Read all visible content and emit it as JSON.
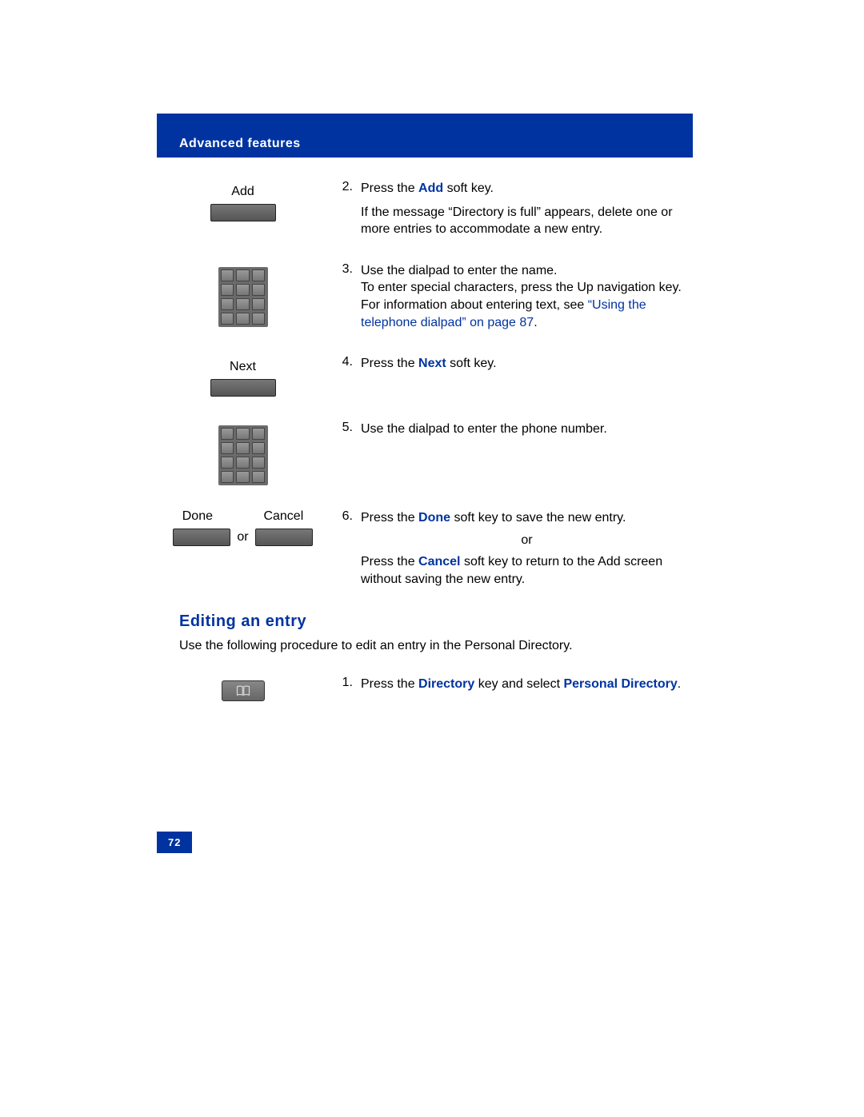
{
  "header": {
    "title": "Advanced features"
  },
  "steps": {
    "s2": {
      "label": "Add",
      "num": "2.",
      "line1_a": "Press the ",
      "line1_b": "Add",
      "line1_c": " soft key.",
      "para": "If the message “Directory is full” appears, delete one or more entries to accommodate a new entry."
    },
    "s3": {
      "num": "3.",
      "line1": "Use the dialpad to enter the name.",
      "line2": "To enter special characters, press the Up navigation key. For information about entering text, see ",
      "link": "“Using the telephone dialpad” on page 87",
      "line2_end": "."
    },
    "s4": {
      "label": "Next",
      "num": "4.",
      "a": "Press the ",
      "b": "Next",
      "c": " soft key."
    },
    "s5": {
      "num": "5.",
      "text": "Use the dialpad to enter the phone number."
    },
    "s6": {
      "label_done": "Done",
      "label_cancel": "Cancel",
      "or": "or",
      "num": "6.",
      "a": "Press the ",
      "b": "Done",
      "c": " soft key to save the new entry.",
      "or_center": "or",
      "d": "Press the ",
      "e": "Cancel",
      "f": " soft key to return to the Add screen without saving the new entry."
    }
  },
  "section2": {
    "heading": "Editing an entry",
    "intro": "Use the following procedure to edit an entry in the Personal Directory.",
    "step1": {
      "num": "1.",
      "a": "Press the ",
      "b": "Directory",
      "c": " key and select ",
      "d": "Personal Directory",
      "e": "."
    }
  },
  "pagenum": "72"
}
